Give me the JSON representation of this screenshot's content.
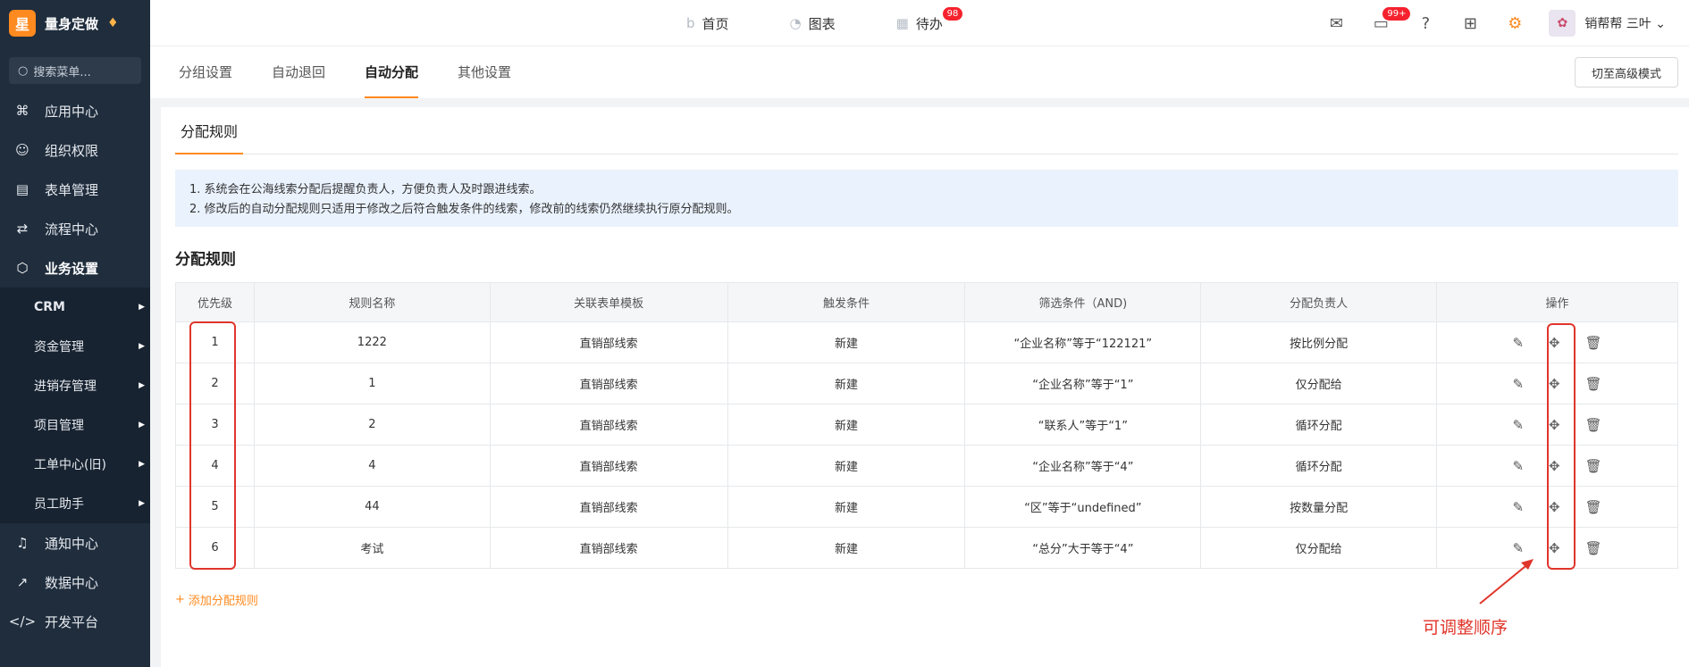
{
  "brand": {
    "logo": "星",
    "name": "量身定做"
  },
  "sidebar": {
    "search_placeholder": "搜索菜单...",
    "items": [
      {
        "label": "应用中心",
        "icon": "apps-icon"
      },
      {
        "label": "组织权限",
        "icon": "user-icon"
      },
      {
        "label": "表单管理",
        "icon": "form-icon"
      },
      {
        "label": "流程中心",
        "icon": "flow-icon"
      },
      {
        "label": "业务设置",
        "icon": "cube-icon"
      }
    ],
    "subitems": [
      {
        "label": "CRM"
      },
      {
        "label": "资金管理"
      },
      {
        "label": "进销存管理"
      },
      {
        "label": "项目管理"
      },
      {
        "label": "工单中心(旧)"
      },
      {
        "label": "员工助手"
      }
    ],
    "bottom_items": [
      {
        "label": "通知中心"
      },
      {
        "label": "数据中心"
      },
      {
        "label": "开发平台"
      }
    ]
  },
  "topnav": {
    "home": "首页",
    "charts": "图表",
    "todo": "待办",
    "todo_badge": "98",
    "msg_badge": "99+",
    "user_name": "销帮帮 三叶"
  },
  "tabs": [
    "分组设置",
    "自动退回",
    "自动分配",
    "其他设置"
  ],
  "advanced_button": "切至高级模式",
  "section_tab": "分配规则",
  "notice": [
    "1. 系统会在公海线索分配后提醒负责人，方便负责人及时跟进线索。",
    "2. 修改后的自动分配规则只适用于修改之后符合触发条件的线索，修改前的线索仍然继续执行原分配规则。"
  ],
  "rules_title": "分配规则",
  "table": {
    "headers": [
      "优先级",
      "规则名称",
      "关联表单模板",
      "触发条件",
      "筛选条件（AND)",
      "分配负责人",
      "操作"
    ],
    "rows": [
      [
        "1",
        "1222",
        "直销部线索",
        "新建",
        "“企业名称”等于“122121”",
        "按比例分配"
      ],
      [
        "2",
        "1",
        "直销部线索",
        "新建",
        "“企业名称”等于“1”",
        "仅分配给"
      ],
      [
        "3",
        "2",
        "直销部线索",
        "新建",
        "“联系人”等于“1”",
        "循环分配"
      ],
      [
        "4",
        "4",
        "直销部线索",
        "新建",
        "“企业名称”等于“4”",
        "循环分配"
      ],
      [
        "5",
        "44",
        "直销部线索",
        "新建",
        "“区”等于“undefined”",
        "按数量分配"
      ],
      [
        "6",
        "考试",
        "直销部线索",
        "新建",
        "“总分”大于等于“4”",
        "仅分配给"
      ]
    ]
  },
  "add_rule": "添加分配规则",
  "annotation": "可调整顺序",
  "colors": {
    "accent": "#ff8a1f",
    "sidebar": "#1f2d3d",
    "annotation": "#e0352b"
  }
}
